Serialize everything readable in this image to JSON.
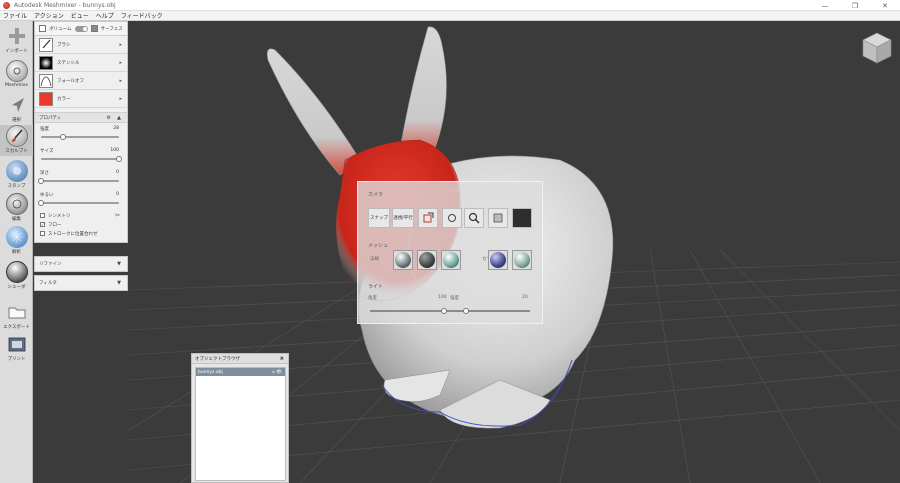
{
  "window": {
    "title": "Autodesk Meshmixer - bunnys.obj",
    "minimize": "—",
    "restore": "❐",
    "close": "✕"
  },
  "menu": [
    "ファイル",
    "アクション",
    "ビュー",
    "ヘルプ",
    "フィードバック"
  ],
  "toolbar": [
    {
      "label": "インポート",
      "icon": "plus-icon"
    },
    {
      "label": "Meshmixx",
      "icon": "meshmix-icon"
    },
    {
      "label": "選択",
      "icon": "select-arrow-icon"
    },
    {
      "label": "スカルプト",
      "icon": "brush-icon"
    },
    {
      "label": "スタンプ",
      "icon": "stamp-icon"
    },
    {
      "label": "編集",
      "icon": "edit-sphere-icon"
    },
    {
      "label": "解析",
      "icon": "analysis-icon"
    },
    {
      "label": "シェーダ",
      "icon": "shader-icon"
    },
    {
      "label": "エクスポート",
      "icon": "export-icon"
    },
    {
      "label": "プリント",
      "icon": "print-icon"
    }
  ],
  "sculpt_panel": {
    "mode_volume": "ボリューム",
    "mode_surface": "サーフェス",
    "brush_label": "ブラシ",
    "stencil_label": "ステンシル",
    "falloff_label": "フォールオフ",
    "color_label": "カラー",
    "color_value": "#e8392c",
    "properties_title": "プロパティ",
    "strength_label": "強度",
    "strength_value": "28",
    "strength_fraction": 0.28,
    "size_label": "サイズ",
    "size_value": "100",
    "size_fraction": 1.0,
    "depth_label": "深さ",
    "depth_value": "0",
    "depth_fraction": 0.0,
    "lazy_label": "ゆるい",
    "lazy_value": "0",
    "lazy_fraction": 0.0,
    "symmetry_label": "シンメトリ",
    "symmetry_checked": false,
    "flow_label": "フロー",
    "flow_checked": true,
    "stroke_label": "ストロークに位置合わせ",
    "stroke_checked": false,
    "refine_label": "リファイン",
    "filter_label": "フィルタ"
  },
  "camera_panel": {
    "title": "カメラ",
    "snap_label": "スナップ",
    "perspective_label": "透視/平行",
    "mesh_title": "メッシュ",
    "shading_label": "法線",
    "color_label": "カラー",
    "light_title": "ライト",
    "light_left": "角度",
    "light_val1": "100",
    "light_mid": "強度",
    "light_right": "20",
    "slider_fraction_1": 0.46,
    "slider_fraction_2": 0.6
  },
  "object_browser": {
    "title": "オブジェクトブラウザ",
    "close": "✖",
    "item": "bunnys.obj",
    "item_icons": "⌂ 👁"
  },
  "colors": {
    "viewport_bg": "#3b3b3b",
    "paint_red": "#e8392c",
    "mesh_white": "#e6e6e6"
  }
}
